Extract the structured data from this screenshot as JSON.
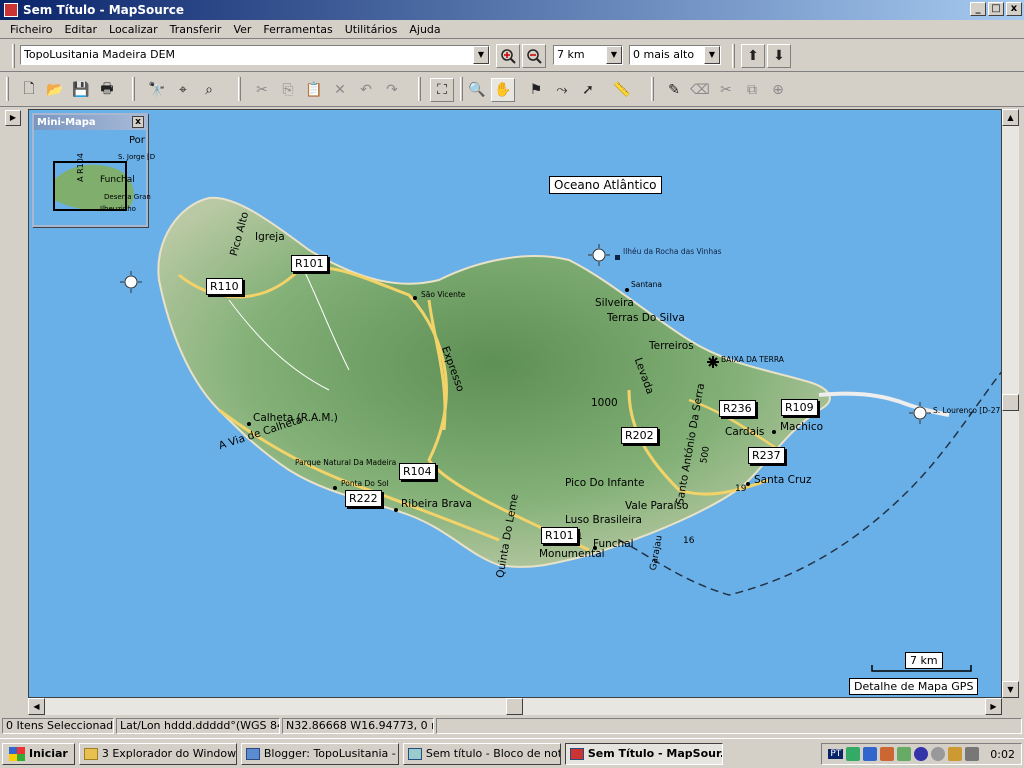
{
  "window": {
    "title": "Sem Título - MapSource",
    "min": "_",
    "max": "□",
    "close": "x"
  },
  "menu": [
    "Ficheiro",
    "Editar",
    "Localizar",
    "Transferir",
    "Ver",
    "Ferramentas",
    "Utilitários",
    "Ajuda"
  ],
  "toolbar": {
    "map_product": "TopoLusitania Madeira DEM",
    "zoom_scale": "7 km",
    "detail_level": "0 mais alto"
  },
  "minimap": {
    "title": "Mini-Mapa",
    "close": "x",
    "labels": [
      "Por",
      "S. Jorge [D",
      "Funchal",
      "Deserta Gran",
      "Ilheuzinho",
      "A R104"
    ]
  },
  "map": {
    "ocean_label": "Oceano Atlântico",
    "scale_label": "7 km",
    "detail_label": "Detalhe de Mapa GPS",
    "roads": [
      "R101",
      "R110",
      "R202",
      "R236",
      "R109",
      "R237",
      "R104",
      "R222",
      "R101"
    ],
    "places": {
      "ilheu": "Ilhéu da Rocha das Vinhas",
      "santana": "Santana",
      "silveira": "Silveira",
      "terras": "Terras Do Silva",
      "terreiros": "Terreiros",
      "baixa": "BAIXA DA TERRA",
      "lourenco": "S. Lourenço [D-27",
      "cardais": "Cardais",
      "machico": "Machico",
      "santacruz": "Santa Cruz",
      "n19": "19",
      "igreja": "Igreja",
      "picoalto": "Pico Alto",
      "saovicente": "São Vicente",
      "expresso": "Expresso",
      "levada": "Levada",
      "n1000": "1000",
      "saoantonio": "Santo António Da Serra",
      "n500": "500",
      "calheta": "Calheta (R.A.M.)",
      "viacalheta": "A Via de Calheta",
      "parque": "Parque Natural Da Madeira",
      "pontadosol": "Ponta Do Sol",
      "ribeirabrava": "Ribeira Brava",
      "picoinfante": "Pico Do Infante",
      "valeparaiso": "Vale Paraíso",
      "lusobrasileira": "Luso Brasileira",
      "funchal": "Funchal",
      "monumental": "Monumental",
      "quintadoleme": "Quinta Do Leme",
      "garajau": "Garajau",
      "n16": "16",
      "n1": "1"
    }
  },
  "status": {
    "selected": "0 Itens Seleccionados",
    "format": "Lat/Lon hddd.ddddd°(WGS 84)",
    "coords": "N32.86668 W16.94773, 0 m",
    "extra": ""
  },
  "taskbar": {
    "start": "Iniciar",
    "tasks": [
      "3 Explorador do Windows ▾",
      "Blogger: TopoLusitania - ...",
      "Sem título - Bloco de notas",
      "Sem Título - MapSour..."
    ],
    "lang": "PT",
    "clock": "0:02"
  },
  "colors": {
    "ocean": "#6ab0e8",
    "land": "#8fb884",
    "road": "#f2d36a",
    "title_bar": "#0a246a"
  }
}
